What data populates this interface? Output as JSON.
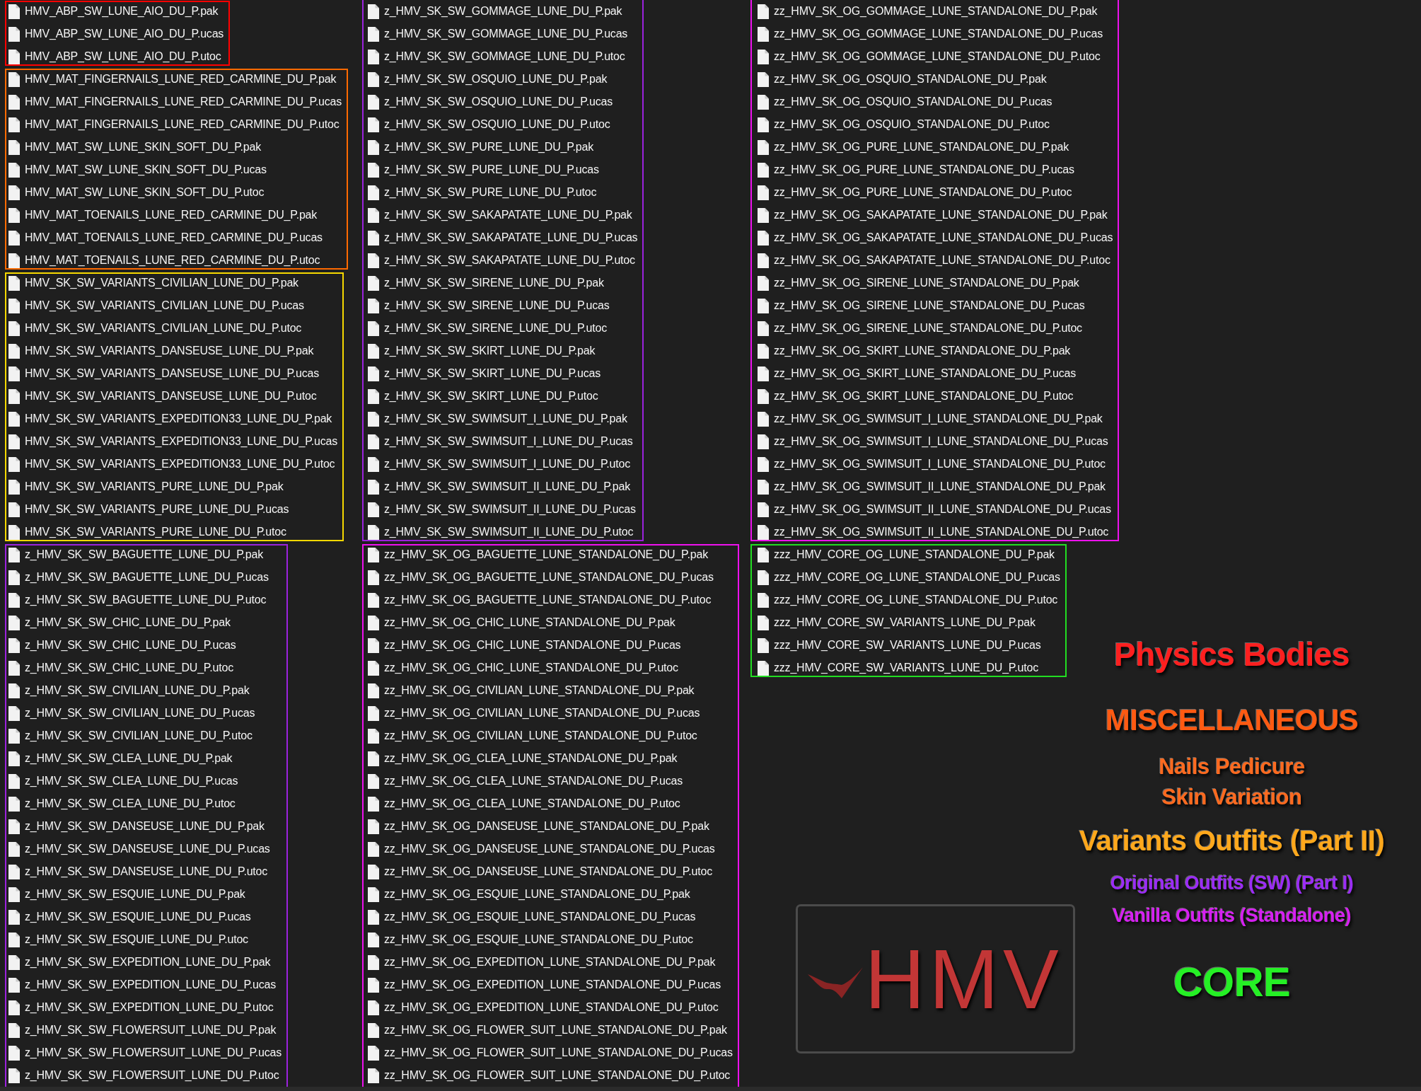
{
  "file_columns": [
    {
      "groups": [
        {
          "color": "#ff0000",
          "open_top": false,
          "open_bottom": false,
          "files": [
            "HMV_ABP_SW_LUNE_AIO_DU_P.pak",
            "HMV_ABP_SW_LUNE_AIO_DU_P.ucas",
            "HMV_ABP_SW_LUNE_AIO_DU_P.utoc"
          ]
        },
        {
          "color": "#ff6a00",
          "open_top": false,
          "open_bottom": false,
          "files": [
            "HMV_MAT_FINGERNAILS_LUNE_RED_CARMINE_DU_P.pak",
            "HMV_MAT_FINGERNAILS_LUNE_RED_CARMINE_DU_P.ucas",
            "HMV_MAT_FINGERNAILS_LUNE_RED_CARMINE_DU_P.utoc",
            "HMV_MAT_SW_LUNE_SKIN_SOFT_DU_P.pak",
            "HMV_MAT_SW_LUNE_SKIN_SOFT_DU_P.ucas",
            "HMV_MAT_SW_LUNE_SKIN_SOFT_DU_P.utoc",
            "HMV_MAT_TOENAILS_LUNE_RED_CARMINE_DU_P.pak",
            "HMV_MAT_TOENAILS_LUNE_RED_CARMINE_DU_P.ucas",
            "HMV_MAT_TOENAILS_LUNE_RED_CARMINE_DU_P.utoc"
          ]
        },
        {
          "color": "#f5d800",
          "open_top": false,
          "open_bottom": false,
          "files": [
            "HMV_SK_SW_VARIANTS_CIVILIAN_LUNE_DU_P.pak",
            "HMV_SK_SW_VARIANTS_CIVILIAN_LUNE_DU_P.ucas",
            "HMV_SK_SW_VARIANTS_CIVILIAN_LUNE_DU_P.utoc",
            "HMV_SK_SW_VARIANTS_DANSEUSE_LUNE_DU_P.pak",
            "HMV_SK_SW_VARIANTS_DANSEUSE_LUNE_DU_P.ucas",
            "HMV_SK_SW_VARIANTS_DANSEUSE_LUNE_DU_P.utoc",
            "HMV_SK_SW_VARIANTS_EXPEDITION33_LUNE_DU_P.pak",
            "HMV_SK_SW_VARIANTS_EXPEDITION33_LUNE_DU_P.ucas",
            "HMV_SK_SW_VARIANTS_EXPEDITION33_LUNE_DU_P.utoc",
            "HMV_SK_SW_VARIANTS_PURE_LUNE_DU_P.pak",
            "HMV_SK_SW_VARIANTS_PURE_LUNE_DU_P.ucas",
            "HMV_SK_SW_VARIANTS_PURE_LUNE_DU_P.utoc"
          ]
        },
        {
          "color": "#9b22dd",
          "open_top": false,
          "open_bottom": true,
          "files": [
            "z_HMV_SK_SW_BAGUETTE_LUNE_DU_P.pak",
            "z_HMV_SK_SW_BAGUETTE_LUNE_DU_P.ucas",
            "z_HMV_SK_SW_BAGUETTE_LUNE_DU_P.utoc",
            "z_HMV_SK_SW_CHIC_LUNE_DU_P.pak",
            "z_HMV_SK_SW_CHIC_LUNE_DU_P.ucas",
            "z_HMV_SK_SW_CHIC_LUNE_DU_P.utoc",
            "z_HMV_SK_SW_CIVILIAN_LUNE_DU_P.pak",
            "z_HMV_SK_SW_CIVILIAN_LUNE_DU_P.ucas",
            "z_HMV_SK_SW_CIVILIAN_LUNE_DU_P.utoc",
            "z_HMV_SK_SW_CLEA_LUNE_DU_P.pak",
            "z_HMV_SK_SW_CLEA_LUNE_DU_P.ucas",
            "z_HMV_SK_SW_CLEA_LUNE_DU_P.utoc",
            "z_HMV_SK_SW_DANSEUSE_LUNE_DU_P.pak",
            "z_HMV_SK_SW_DANSEUSE_LUNE_DU_P.ucas",
            "z_HMV_SK_SW_DANSEUSE_LUNE_DU_P.utoc",
            "z_HMV_SK_SW_ESQUIE_LUNE_DU_P.pak",
            "z_HMV_SK_SW_ESQUIE_LUNE_DU_P.ucas",
            "z_HMV_SK_SW_ESQUIE_LUNE_DU_P.utoc",
            "z_HMV_SK_SW_EXPEDITION_LUNE_DU_P.pak",
            "z_HMV_SK_SW_EXPEDITION_LUNE_DU_P.ucas",
            "z_HMV_SK_SW_EXPEDITION_LUNE_DU_P.utoc",
            "z_HMV_SK_SW_FLOWERSUIT_LUNE_DU_P.pak",
            "z_HMV_SK_SW_FLOWERSUIT_LUNE_DU_P.ucas",
            "z_HMV_SK_SW_FLOWERSUIT_LUNE_DU_P.utoc"
          ]
        }
      ]
    },
    {
      "groups": [
        {
          "color": "#9b22dd",
          "open_top": true,
          "open_bottom": false,
          "files": [
            "z_HMV_SK_SW_GOMMAGE_LUNE_DU_P.pak",
            "z_HMV_SK_SW_GOMMAGE_LUNE_DU_P.ucas",
            "z_HMV_SK_SW_GOMMAGE_LUNE_DU_P.utoc",
            "z_HMV_SK_SW_OSQUIO_LUNE_DU_P.pak",
            "z_HMV_SK_SW_OSQUIO_LUNE_DU_P.ucas",
            "z_HMV_SK_SW_OSQUIO_LUNE_DU_P.utoc",
            "z_HMV_SK_SW_PURE_LUNE_DU_P.pak",
            "z_HMV_SK_SW_PURE_LUNE_DU_P.ucas",
            "z_HMV_SK_SW_PURE_LUNE_DU_P.utoc",
            "z_HMV_SK_SW_SAKAPATATE_LUNE_DU_P.pak",
            "z_HMV_SK_SW_SAKAPATATE_LUNE_DU_P.ucas",
            "z_HMV_SK_SW_SAKAPATATE_LUNE_DU_P.utoc",
            "z_HMV_SK_SW_SIRENE_LUNE_DU_P.pak",
            "z_HMV_SK_SW_SIRENE_LUNE_DU_P.ucas",
            "z_HMV_SK_SW_SIRENE_LUNE_DU_P.utoc",
            "z_HMV_SK_SW_SKIRT_LUNE_DU_P.pak",
            "z_HMV_SK_SW_SKIRT_LUNE_DU_P.ucas",
            "z_HMV_SK_SW_SKIRT_LUNE_DU_P.utoc",
            "z_HMV_SK_SW_SWIMSUIT_I_LUNE_DU_P.pak",
            "z_HMV_SK_SW_SWIMSUIT_I_LUNE_DU_P.ucas",
            "z_HMV_SK_SW_SWIMSUIT_I_LUNE_DU_P.utoc",
            "z_HMV_SK_SW_SWIMSUIT_II_LUNE_DU_P.pak",
            "z_HMV_SK_SW_SWIMSUIT_II_LUNE_DU_P.ucas",
            "z_HMV_SK_SW_SWIMSUIT_II_LUNE_DU_P.utoc"
          ]
        },
        {
          "color": "#ee11ee",
          "open_top": false,
          "open_bottom": true,
          "files": [
            "zz_HMV_SK_OG_BAGUETTE_LUNE_STANDALONE_DU_P.pak",
            "zz_HMV_SK_OG_BAGUETTE_LUNE_STANDALONE_DU_P.ucas",
            "zz_HMV_SK_OG_BAGUETTE_LUNE_STANDALONE_DU_P.utoc",
            "zz_HMV_SK_OG_CHIC_LUNE_STANDALONE_DU_P.pak",
            "zz_HMV_SK_OG_CHIC_LUNE_STANDALONE_DU_P.ucas",
            "zz_HMV_SK_OG_CHIC_LUNE_STANDALONE_DU_P.utoc",
            "zz_HMV_SK_OG_CIVILIAN_LUNE_STANDALONE_DU_P.pak",
            "zz_HMV_SK_OG_CIVILIAN_LUNE_STANDALONE_DU_P.ucas",
            "zz_HMV_SK_OG_CIVILIAN_LUNE_STANDALONE_DU_P.utoc",
            "zz_HMV_SK_OG_CLEA_LUNE_STANDALONE_DU_P.pak",
            "zz_HMV_SK_OG_CLEA_LUNE_STANDALONE_DU_P.ucas",
            "zz_HMV_SK_OG_CLEA_LUNE_STANDALONE_DU_P.utoc",
            "zz_HMV_SK_OG_DANSEUSE_LUNE_STANDALONE_DU_P.pak",
            "zz_HMV_SK_OG_DANSEUSE_LUNE_STANDALONE_DU_P.ucas",
            "zz_HMV_SK_OG_DANSEUSE_LUNE_STANDALONE_DU_P.utoc",
            "zz_HMV_SK_OG_ESQUIE_LUNE_STANDALONE_DU_P.pak",
            "zz_HMV_SK_OG_ESQUIE_LUNE_STANDALONE_DU_P.ucas",
            "zz_HMV_SK_OG_ESQUIE_LUNE_STANDALONE_DU_P.utoc",
            "zz_HMV_SK_OG_EXPEDITION_LUNE_STANDALONE_DU_P.pak",
            "zz_HMV_SK_OG_EXPEDITION_LUNE_STANDALONE_DU_P.ucas",
            "zz_HMV_SK_OG_EXPEDITION_LUNE_STANDALONE_DU_P.utoc",
            "zz_HMV_SK_OG_FLOWER_SUIT_LUNE_STANDALONE_DU_P.pak",
            "zz_HMV_SK_OG_FLOWER_SUIT_LUNE_STANDALONE_DU_P.ucas",
            "zz_HMV_SK_OG_FLOWER_SUIT_LUNE_STANDALONE_DU_P.utoc"
          ]
        }
      ]
    },
    {
      "groups": [
        {
          "color": "#ee11ee",
          "open_top": true,
          "open_bottom": false,
          "files": [
            "zz_HMV_SK_OG_GOMMAGE_LUNE_STANDALONE_DU_P.pak",
            "zz_HMV_SK_OG_GOMMAGE_LUNE_STANDALONE_DU_P.ucas",
            "zz_HMV_SK_OG_GOMMAGE_LUNE_STANDALONE_DU_P.utoc",
            "zz_HMV_SK_OG_OSQUIO_STANDALONE_DU_P.pak",
            "zz_HMV_SK_OG_OSQUIO_STANDALONE_DU_P.ucas",
            "zz_HMV_SK_OG_OSQUIO_STANDALONE_DU_P.utoc",
            "zz_HMV_SK_OG_PURE_LUNE_STANDALONE_DU_P.pak",
            "zz_HMV_SK_OG_PURE_LUNE_STANDALONE_DU_P.ucas",
            "zz_HMV_SK_OG_PURE_LUNE_STANDALONE_DU_P.utoc",
            "zz_HMV_SK_OG_SAKAPATATE_LUNE_STANDALONE_DU_P.pak",
            "zz_HMV_SK_OG_SAKAPATATE_LUNE_STANDALONE_DU_P.ucas",
            "zz_HMV_SK_OG_SAKAPATATE_LUNE_STANDALONE_DU_P.utoc",
            "zz_HMV_SK_OG_SIRENE_LUNE_STANDALONE_DU_P.pak",
            "zz_HMV_SK_OG_SIRENE_LUNE_STANDALONE_DU_P.ucas",
            "zz_HMV_SK_OG_SIRENE_LUNE_STANDALONE_DU_P.utoc",
            "zz_HMV_SK_OG_SKIRT_LUNE_STANDALONE_DU_P.pak",
            "zz_HMV_SK_OG_SKIRT_LUNE_STANDALONE_DU_P.ucas",
            "zz_HMV_SK_OG_SKIRT_LUNE_STANDALONE_DU_P.utoc",
            "zz_HMV_SK_OG_SWIMSUIT_I_LUNE_STANDALONE_DU_P.pak",
            "zz_HMV_SK_OG_SWIMSUIT_I_LUNE_STANDALONE_DU_P.ucas",
            "zz_HMV_SK_OG_SWIMSUIT_I_LUNE_STANDALONE_DU_P.utoc",
            "zz_HMV_SK_OG_SWIMSUIT_II_LUNE_STANDALONE_DU_P.pak",
            "zz_HMV_SK_OG_SWIMSUIT_II_LUNE_STANDALONE_DU_P.ucas",
            "zz_HMV_SK_OG_SWIMSUIT_II_LUNE_STANDALONE_DU_P.utoc"
          ]
        },
        {
          "color": "#22dd22",
          "open_top": false,
          "open_bottom": false,
          "files": [
            "zzz_HMV_CORE_OG_LUNE_STANDALONE_DU_P.pak",
            "zzz_HMV_CORE_OG_LUNE_STANDALONE_DU_P.ucas",
            "zzz_HMV_CORE_OG_LUNE_STANDALONE_DU_P.utoc",
            "zzz_HMV_CORE_SW_VARIANTS_LUNE_DU_P.pak",
            "zzz_HMV_CORE_SW_VARIANTS_LUNE_DU_P.ucas",
            "zzz_HMV_CORE_SW_VARIANTS_LUNE_DU_P.utoc"
          ]
        }
      ]
    }
  ],
  "logo": {
    "text": "HMV"
  },
  "legend": [
    {
      "label": "Physics Bodies",
      "color": "#ff1f1f"
    },
    {
      "label": "MISCELLANEOUS",
      "color": "#ff5a12"
    },
    {
      "label": "Nails Pedicure",
      "color": "#ff6a1f"
    },
    {
      "label": "Skin Variation",
      "color": "#ff6a1f"
    },
    {
      "label": "Variants Outfits (Part II)",
      "color": "#ffa81c"
    },
    {
      "label": "Original Outfits (SW) (Part I)",
      "color": "#9b2cf7"
    },
    {
      "label": "Vanilla Outfits (Standalone)",
      "color": "#d61ff2"
    },
    {
      "label": "CORE",
      "color": "#25f025"
    }
  ]
}
